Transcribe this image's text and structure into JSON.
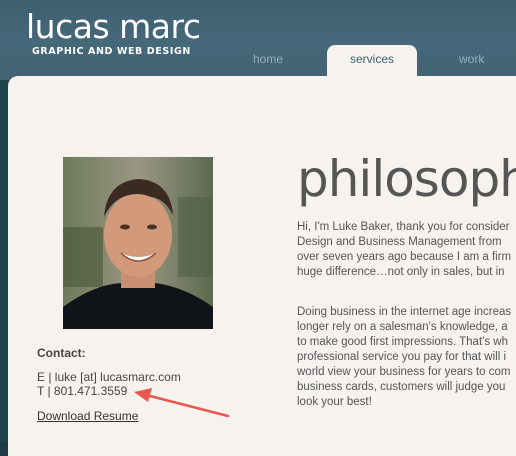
{
  "brand": {
    "name": "lucas marc",
    "tagline": "GRAPHIC AND WEB DESIGN"
  },
  "nav": {
    "tabs": [
      {
        "label": "home",
        "active": false
      },
      {
        "label": "services",
        "active": true
      },
      {
        "label": "work",
        "active": false
      }
    ]
  },
  "profile": {
    "photo_description_icon": "portrait-photo"
  },
  "contact": {
    "heading": "Contact:",
    "email": "E | luke [at] lucasmarc.com",
    "phone": "T | 801.471.3559",
    "resume_link": "Download Resume"
  },
  "main": {
    "title": "philosoph",
    "paragraph1": [
      "Hi, I'm Luke Baker, thank you for consider",
      "Design and Business Management from",
      "over seven years ago because I am a firm",
      "huge difference…not only in sales, but in"
    ],
    "paragraph2": [
      "Doing business in the internet age increas",
      "longer rely on a salesman's knowledge, a",
      "to make good first impressions. That's wh",
      "professional service you pay for that will i",
      "world view your business for years to com",
      "business cards, customers will judge you",
      "look your best!"
    ]
  },
  "colors": {
    "header": "#45687a",
    "content_bg": "#f6f3ef",
    "annotation_arrow": "#e8574f"
  }
}
